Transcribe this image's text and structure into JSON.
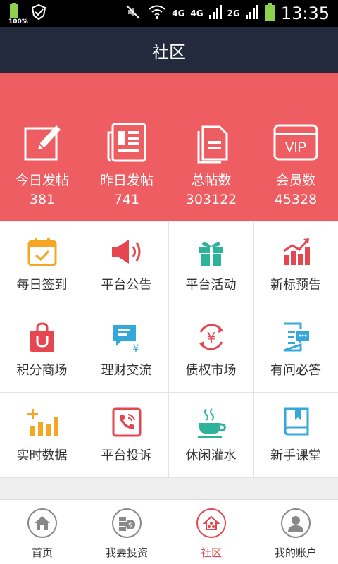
{
  "status_bar": {
    "battery_percent": "100%",
    "network_1": "4G",
    "network_2": "4G",
    "network_3": "2G",
    "time": "13:35"
  },
  "header": {
    "title": "社区"
  },
  "stats": [
    {
      "label": "今日发帖",
      "value": "381",
      "icon": "edit-icon"
    },
    {
      "label": "昨日发帖",
      "value": "741",
      "icon": "newspaper-icon"
    },
    {
      "label": "总帖数",
      "value": "303122",
      "icon": "documents-icon"
    },
    {
      "label": "会员数",
      "value": "45328",
      "icon": "vip-icon",
      "badge_text": "VIP"
    }
  ],
  "grid": [
    {
      "label": "每日签到",
      "icon": "calendar-check-icon",
      "color": "#f5a623"
    },
    {
      "label": "平台公告",
      "icon": "megaphone-icon",
      "color": "#e4474f"
    },
    {
      "label": "平台活动",
      "icon": "gift-icon",
      "color": "#2cb39a"
    },
    {
      "label": "新标预告",
      "icon": "bar-chart-icon",
      "color": "#e4474f"
    },
    {
      "label": "积分商场",
      "icon": "shopping-bag-icon",
      "color": "#e4474f"
    },
    {
      "label": "理财交流",
      "icon": "chat-yuan-icon",
      "color": "#35a8db"
    },
    {
      "label": "债权市场",
      "icon": "yuan-exchange-icon",
      "color": "#e4474f"
    },
    {
      "label": "有问必答",
      "icon": "qa-document-icon",
      "color": "#35a8db"
    },
    {
      "label": "实时数据",
      "icon": "realtime-chart-icon",
      "color": "#f5a623"
    },
    {
      "label": "平台投诉",
      "icon": "phone-complaint-icon",
      "color": "#e4474f"
    },
    {
      "label": "休闲灌水",
      "icon": "coffee-cup-icon",
      "color": "#2cb39a"
    },
    {
      "label": "新手课堂",
      "icon": "book-icon",
      "color": "#35a8db"
    }
  ],
  "tabbar": [
    {
      "label": "首页",
      "icon": "home-icon",
      "active": false
    },
    {
      "label": "我要投资",
      "icon": "invest-icon",
      "active": false
    },
    {
      "label": "社区",
      "icon": "community-icon",
      "active": true
    },
    {
      "label": "我的账户",
      "icon": "account-icon",
      "active": false
    }
  ],
  "colors": {
    "header_bg": "#242a3d",
    "stats_bg": "#ee5d62",
    "accent": "#e4474f"
  }
}
